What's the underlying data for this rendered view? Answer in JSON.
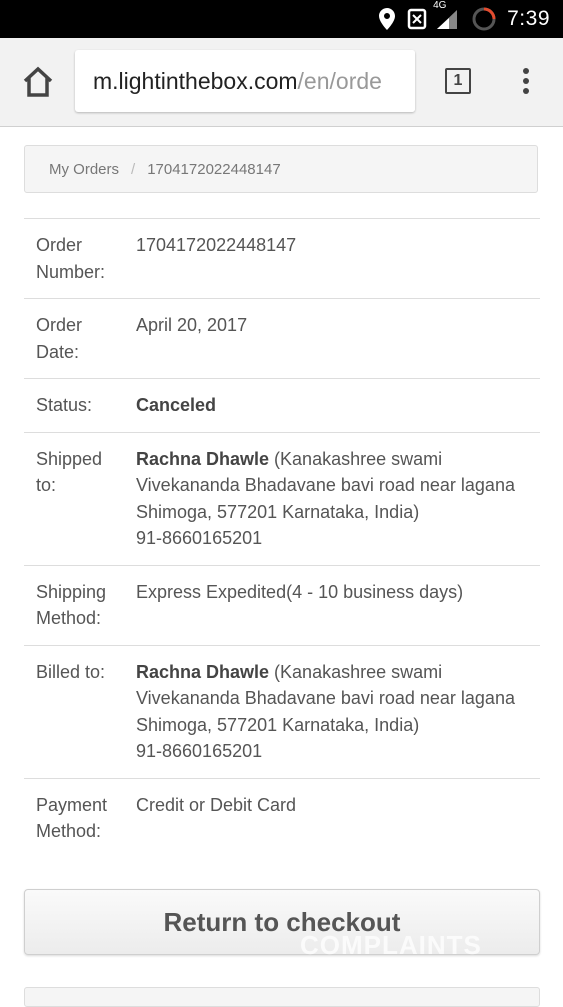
{
  "status_bar": {
    "time": "7:39",
    "network": "4G",
    "icons": [
      "location-icon",
      "nfc-icon",
      "signal-icon",
      "loading-ring-icon"
    ]
  },
  "browser": {
    "url_host": "m.lightinthebox.com",
    "url_path": "/en/orde",
    "tab_count": "1",
    "icons": [
      "home-icon",
      "tabs-icon",
      "overflow-menu-icon"
    ]
  },
  "breadcrumb": {
    "items": [
      "My Orders",
      "1704172022448147"
    ],
    "separator": "/"
  },
  "order": {
    "rows": [
      {
        "label_1": "Order",
        "label_2": "Number:",
        "value": "1704172022448147"
      },
      {
        "label_1": "Order",
        "label_2": "Date:",
        "value": "April 20, 2017"
      },
      {
        "label_1": "Status:",
        "value": "Canceled"
      },
      {
        "label_1": "Shipped",
        "label_2": "to:",
        "name": "Rachna Dhawle",
        "address": " (Kanakashree swami Vivekananda Bhadavane bavi road near lagana Shimoga, 577201 Karnataka, India)",
        "phone": "91-8660165201"
      },
      {
        "label_1": "Shipping",
        "label_2": "Method:",
        "value": "Express Expedited(4 - 10 business days)"
      },
      {
        "label_1": "Billed to:",
        "name": "Rachna Dhawle",
        "address": " (Kanakashree swami Vivekananda Bhadavane bavi road near lagana Shimoga, 577201 Karnataka, India)",
        "phone": "91-8660165201"
      },
      {
        "label_1": "Payment",
        "label_2": "Method:",
        "value": "Credit or Debit Card"
      }
    ]
  },
  "actions": {
    "return_label": "Return to checkout"
  },
  "watermark": "COMPLAINTS"
}
